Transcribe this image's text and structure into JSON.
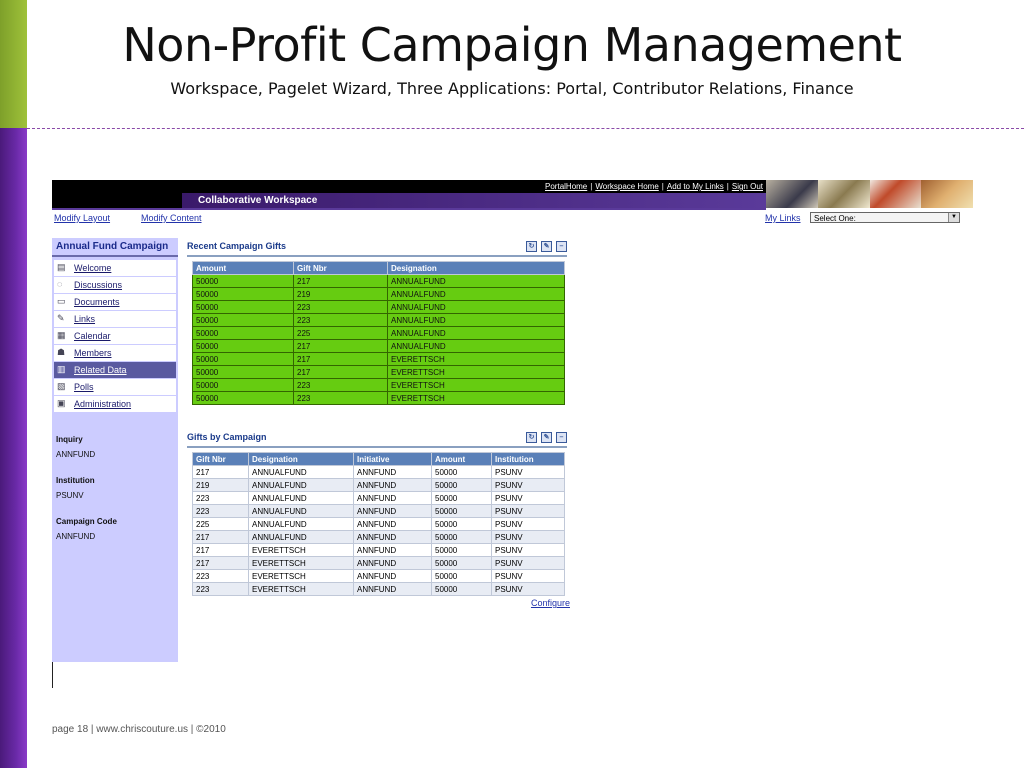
{
  "slide": {
    "title": "Non-Profit Campaign Management",
    "subtitle": "Workspace, Pagelet Wizard, Three Applications: Portal, Contributor Relations, Finance",
    "footer": "page 18 | www.chriscouture.us | ©2010"
  },
  "topbar": {
    "links": [
      "PortalHome",
      "Workspace Home",
      "Add to My Links",
      "Sign Out"
    ],
    "separator": "|",
    "workspace_label": "Collaborative Workspace"
  },
  "modbar": {
    "modify_layout": "Modify Layout",
    "modify_content": "Modify Content",
    "my_links": "My Links",
    "select_value": "Select One:"
  },
  "sidebar": {
    "title": "Annual Fund Campaign",
    "items": [
      {
        "label": "Welcome",
        "icon": "calendar-page-icon"
      },
      {
        "label": "Discussions",
        "icon": "speech-bubble-icon"
      },
      {
        "label": "Documents",
        "icon": "folder-icon"
      },
      {
        "label": "Links",
        "icon": "link-icon"
      },
      {
        "label": "Calendar",
        "icon": "calendar-icon"
      },
      {
        "label": "Members",
        "icon": "members-icon"
      },
      {
        "label": "Related Data",
        "icon": "data-icon"
      },
      {
        "label": "Polls",
        "icon": "poll-icon"
      },
      {
        "label": "Administration",
        "icon": "admin-icon"
      }
    ],
    "active_item": "Related Data",
    "fields": [
      {
        "label": "Inquiry",
        "value": "ANNFUND"
      },
      {
        "label": "Institution",
        "value": "PSUNV"
      },
      {
        "label": "Campaign Code",
        "value": "ANNFUND"
      }
    ]
  },
  "recent_gifts": {
    "title": "Recent Campaign Gifts",
    "columns": [
      "Amount",
      "Gift Nbr",
      "Designation"
    ],
    "rows": [
      [
        "50000",
        "217",
        "ANNUALFUND"
      ],
      [
        "50000",
        "219",
        "ANNUALFUND"
      ],
      [
        "50000",
        "223",
        "ANNUALFUND"
      ],
      [
        "50000",
        "223",
        "ANNUALFUND"
      ],
      [
        "50000",
        "225",
        "ANNUALFUND"
      ],
      [
        "50000",
        "217",
        "ANNUALFUND"
      ],
      [
        "50000",
        "217",
        "EVERETTSCH"
      ],
      [
        "50000",
        "217",
        "EVERETTSCH"
      ],
      [
        "50000",
        "223",
        "EVERETTSCH"
      ],
      [
        "50000",
        "223",
        "EVERETTSCH"
      ]
    ]
  },
  "gifts_by_campaign": {
    "title": "Gifts by Campaign",
    "columns": [
      "Gift Nbr",
      "Designation",
      "Initiative",
      "Amount",
      "Institution"
    ],
    "rows": [
      [
        "217",
        "ANNUALFUND",
        "ANNFUND",
        "50000",
        "PSUNV"
      ],
      [
        "219",
        "ANNUALFUND",
        "ANNFUND",
        "50000",
        "PSUNV"
      ],
      [
        "223",
        "ANNUALFUND",
        "ANNFUND",
        "50000",
        "PSUNV"
      ],
      [
        "223",
        "ANNUALFUND",
        "ANNFUND",
        "50000",
        "PSUNV"
      ],
      [
        "225",
        "ANNUALFUND",
        "ANNFUND",
        "50000",
        "PSUNV"
      ],
      [
        "217",
        "ANNUALFUND",
        "ANNFUND",
        "50000",
        "PSUNV"
      ],
      [
        "217",
        "EVERETTSCH",
        "ANNFUND",
        "50000",
        "PSUNV"
      ],
      [
        "217",
        "EVERETTSCH",
        "ANNFUND",
        "50000",
        "PSUNV"
      ],
      [
        "223",
        "EVERETTSCH",
        "ANNFUND",
        "50000",
        "PSUNV"
      ],
      [
        "223",
        "EVERETTSCH",
        "ANNFUND",
        "50000",
        "PSUNV"
      ]
    ],
    "configure_label": "Configure"
  },
  "pagelet_controls": [
    "refresh-icon",
    "edit-icon",
    "minimize-icon"
  ],
  "colors": {
    "green_rows": "#66cc11",
    "header_blue": "#5a80b8",
    "workspace_purple": "#5a3a9a",
    "sidebar_lavender": "#ccccff"
  }
}
